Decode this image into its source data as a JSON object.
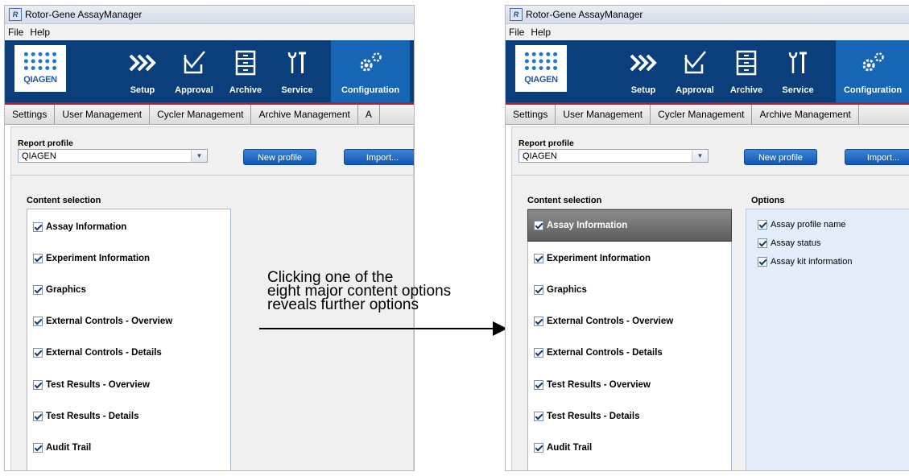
{
  "app": {
    "title": "Rotor-Gene AssayManager",
    "menu": [
      "File",
      "Help"
    ],
    "logo_text": "QIAGEN"
  },
  "nav": [
    {
      "label": "Setup",
      "icon": "setup-chevrons-icon"
    },
    {
      "label": "Approval",
      "icon": "approval-check-icon"
    },
    {
      "label": "Archive",
      "icon": "archive-cabinet-icon"
    },
    {
      "label": "Service",
      "icon": "service-tools-icon"
    },
    {
      "label": "Configuration",
      "icon": "configuration-gears-icon",
      "active": true
    }
  ],
  "tabs": [
    "Settings",
    "User Management",
    "Cycler Management",
    "Archive Management",
    "A"
  ],
  "report_profile": {
    "label": "Report profile",
    "selected": "QIAGEN",
    "new_profile_label": "New profile",
    "import_label": "Import..."
  },
  "content_selection": {
    "title": "Content selection",
    "items": [
      "Assay Information",
      "Experiment Information",
      "Graphics",
      "External Controls - Overview",
      "External Controls - Details",
      "Test Results - Overview",
      "Test Results - Details",
      "Audit Trail"
    ]
  },
  "options": {
    "title": "Options",
    "items": [
      "Assay profile name",
      "Assay status",
      "Assay kit information"
    ]
  },
  "annotation": {
    "lines": [
      "Clicking one of the",
      "eight major content options",
      "reveals further options"
    ]
  },
  "colors": {
    "nav_bg": "#0a3f7c",
    "nav_active": "#1765b5",
    "accent_red": "#b41e3c",
    "options_bg": "#e3edf9",
    "selected_item": "#6e6e6e"
  }
}
